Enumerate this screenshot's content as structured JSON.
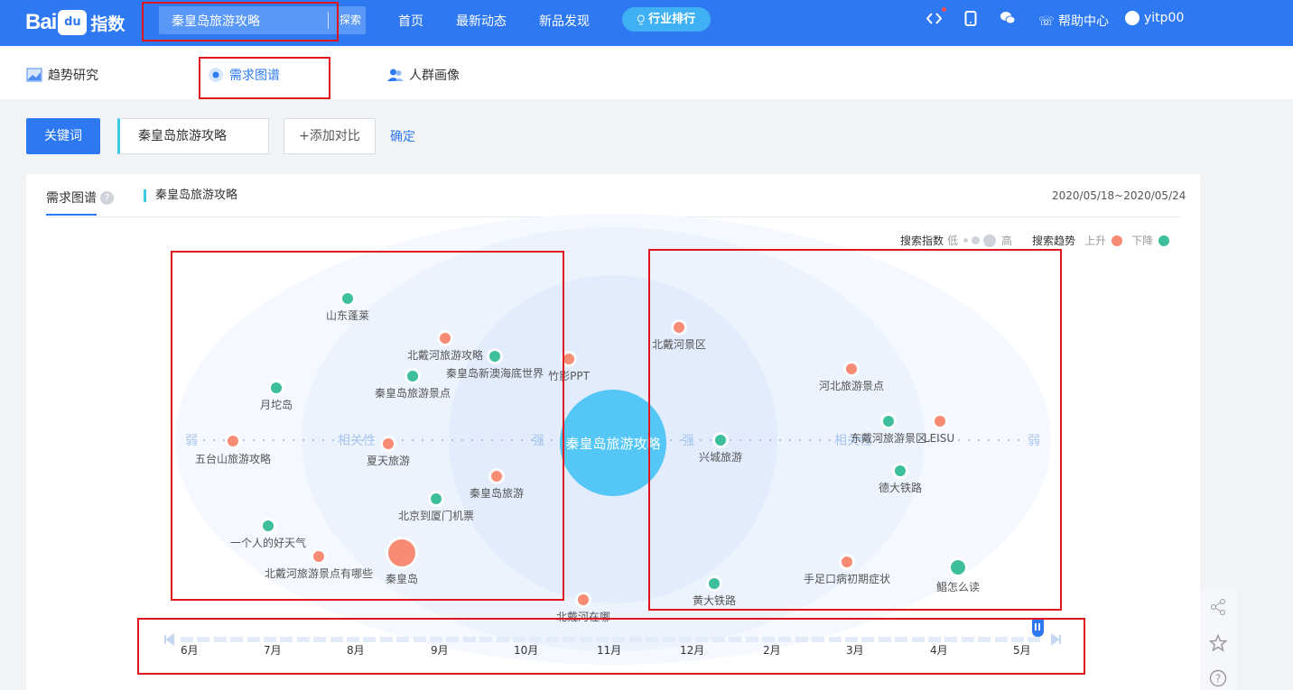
{
  "header": {
    "logo_text_bai": "Bai",
    "logo_text_du": "du",
    "logo_text_index": "指数",
    "search_value": "秦皇岛旅游攻略",
    "search_button": "探索",
    "nav": [
      "首页",
      "最新动态",
      "新品发现"
    ],
    "rank_button": "行业排行",
    "help": "帮助中心",
    "username": "yitp00",
    "icons": [
      "code-icon",
      "mobile-icon",
      "wechat-icon",
      "help-chat-icon",
      "user-avatar-icon"
    ]
  },
  "subnav": {
    "tabs": [
      "趋势研究",
      "需求图谱",
      "人群画像"
    ],
    "active": "需求图谱"
  },
  "controls": {
    "keyword_button": "关键词",
    "keyword_value": "秦皇岛旅游攻略",
    "add_compare": "+添加对比",
    "confirm": "确定"
  },
  "panel": {
    "tab": "需求图谱",
    "help_glyph": "?",
    "keyword": "秦皇岛旅游攻略",
    "date_range": "2020/05/18~2020/05/24",
    "legend": {
      "index_label": "搜索指数",
      "low": "低",
      "high": "高",
      "trend_label": "搜索趋势",
      "up": "上升",
      "down": "下降",
      "up_color": "#f78b73",
      "down_color": "#3dbf9b"
    }
  },
  "chart_data": {
    "type": "scatter",
    "center": "秦皇岛旅游攻略",
    "axis_labels": {
      "left_weak": "弱",
      "left_mid": "相关性",
      "left_strong": "强",
      "right_strong": "强",
      "right_mid": "相关性",
      "right_weak": "弱"
    },
    "nodes": [
      {
        "label": "山东蓬莱",
        "trend": "down"
      },
      {
        "label": "北戴河旅游攻略",
        "trend": "up"
      },
      {
        "label": "秦皇岛新澳海底世界",
        "trend": "down"
      },
      {
        "label": "竹影PPT",
        "trend": "up"
      },
      {
        "label": "秦皇岛旅游景点",
        "trend": "down"
      },
      {
        "label": "月坨岛",
        "trend": "down"
      },
      {
        "label": "五台山旅游攻略",
        "trend": "up"
      },
      {
        "label": "夏天旅游",
        "trend": "up"
      },
      {
        "label": "秦皇岛旅游",
        "trend": "up"
      },
      {
        "label": "北京到厦门机票",
        "trend": "down"
      },
      {
        "label": "一个人的好天气",
        "trend": "down"
      },
      {
        "label": "北戴河旅游景点有哪些",
        "trend": "up"
      },
      {
        "label": "秦皇岛",
        "trend": "up"
      },
      {
        "label": "北戴河在哪",
        "trend": "up"
      },
      {
        "label": "北戴河景区",
        "trend": "up"
      },
      {
        "label": "河北旅游景点",
        "trend": "up"
      },
      {
        "label": "东戴河旅游景区",
        "trend": "down"
      },
      {
        "label": "LEISU",
        "trend": "up"
      },
      {
        "label": "兴城旅游",
        "trend": "down"
      },
      {
        "label": "德大铁路",
        "trend": "down"
      },
      {
        "label": "手足口病初期症状",
        "trend": "up"
      },
      {
        "label": "鲳怎么读",
        "trend": "down"
      },
      {
        "label": "黄大铁路",
        "trend": "down"
      }
    ]
  },
  "timeline": {
    "months": [
      "6月",
      "7月",
      "8月",
      "9月",
      "10月",
      "11月",
      "12月",
      "2月",
      "3月",
      "4月",
      "5月"
    ]
  },
  "tools": [
    "share-icon",
    "star-icon",
    "question-icon"
  ]
}
